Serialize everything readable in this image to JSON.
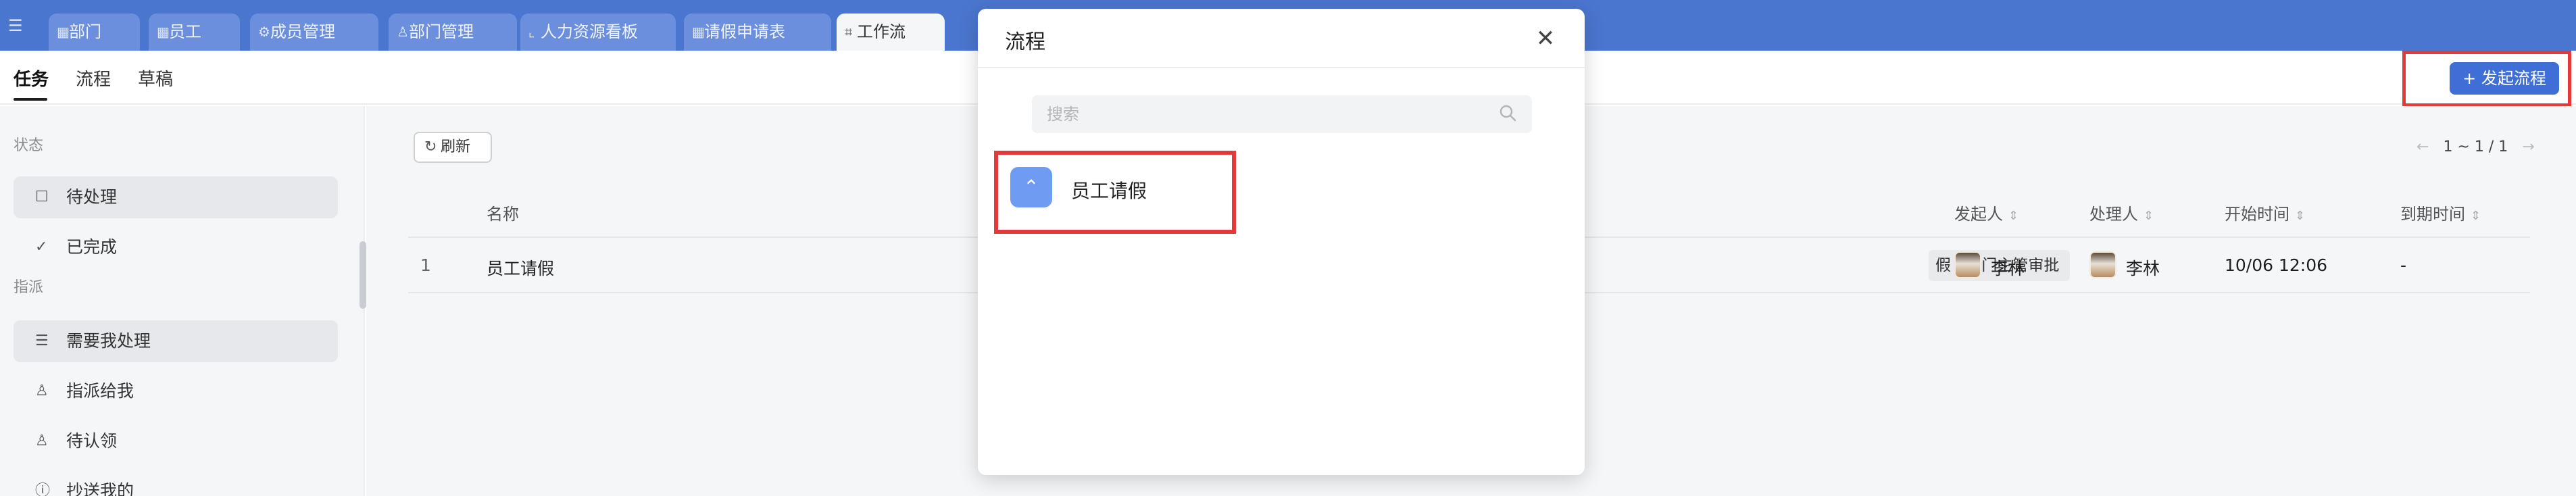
{
  "topbar": {
    "tabs": [
      {
        "icon": "table-icon",
        "glyph": "▦",
        "label": "部门"
      },
      {
        "icon": "table-icon",
        "glyph": "▦",
        "label": "员工"
      },
      {
        "icon": "gear-icon",
        "glyph": "⚙",
        "label": "成员管理"
      },
      {
        "icon": "org-icon",
        "glyph": "♙",
        "label": "部门管理"
      },
      {
        "icon": "chart-icon",
        "glyph": "⌞",
        "label": "人力资源看板"
      },
      {
        "icon": "table-icon",
        "glyph": "▦",
        "label": "请假申请表"
      },
      {
        "icon": "workflow-icon",
        "glyph": "⌗",
        "label": "工作流"
      }
    ]
  },
  "subbar": {
    "tabs": [
      "任务",
      "流程",
      "草稿"
    ],
    "start_button": "+ 发起流程"
  },
  "sidebar": {
    "section_status": "状态",
    "section_assign": "指派",
    "items": [
      {
        "label": "待处理",
        "glyph": "☐"
      },
      {
        "label": "已完成",
        "glyph": "✓"
      },
      {
        "label": "需要我处理",
        "glyph": "☰"
      },
      {
        "label": "指派给我",
        "glyph": "♙"
      },
      {
        "label": "待认领",
        "glyph": "♙"
      },
      {
        "label": "抄送我的",
        "glyph": "ⓘ"
      }
    ]
  },
  "main": {
    "refresh_label": "刷新",
    "pager": "1 ~ 1 / 1",
    "columns": {
      "name": "名称",
      "initiator": "发起人",
      "handler": "处理人",
      "start_time": "开始时间",
      "due_time": "到期时间"
    },
    "rows": [
      {
        "index": "1",
        "name": "员工请假",
        "step": "假 / 部门主管审批",
        "initiator": "李林",
        "handler": "李林",
        "start_time": "10/06 12:06",
        "due_time": "-"
      }
    ]
  },
  "modal": {
    "title": "流程",
    "search_placeholder": "搜索",
    "items": [
      {
        "label": "员工请假"
      }
    ]
  },
  "colors": {
    "topbar": "#4b76cf",
    "primary_button": "#3f6ed6",
    "highlight": "#e23a3a",
    "flow_icon": "#6f9cf2"
  }
}
